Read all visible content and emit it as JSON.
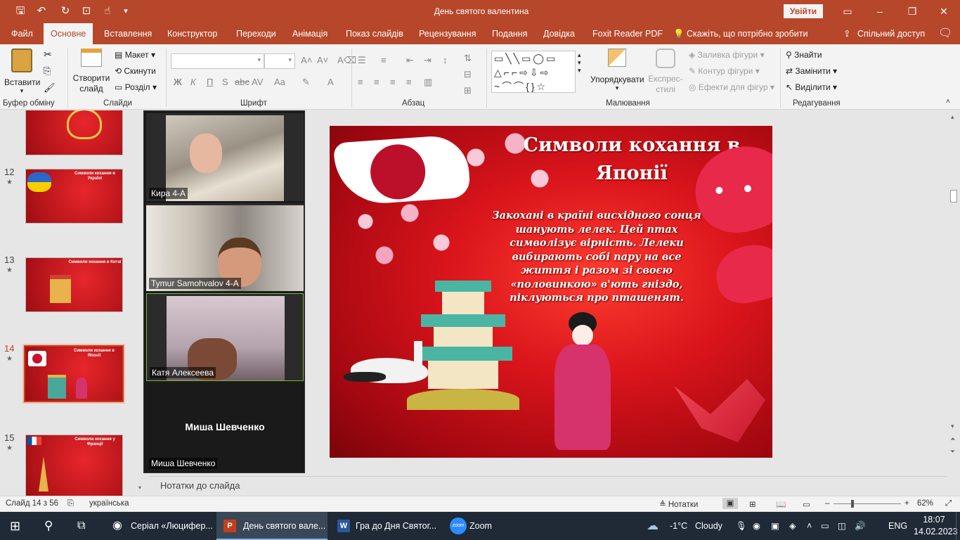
{
  "window": {
    "title": "День святого валентина",
    "signin_label": "Увійти",
    "qat": [
      "save-icon",
      "undo-icon",
      "redo-icon",
      "present-icon",
      "touch-icon",
      "customize-icon"
    ]
  },
  "tabs": [
    {
      "label": "Файл",
      "active": false
    },
    {
      "label": "Основне",
      "active": true
    },
    {
      "label": "Вставлення",
      "active": false
    },
    {
      "label": "Конструктор",
      "active": false
    },
    {
      "label": "Переходи",
      "active": false
    },
    {
      "label": "Анімація",
      "active": false
    },
    {
      "label": "Показ слайдів",
      "active": false
    },
    {
      "label": "Рецензування",
      "active": false
    },
    {
      "label": "Подання",
      "active": false
    },
    {
      "label": "Довідка",
      "active": false
    },
    {
      "label": "Foxit Reader PDF",
      "active": false
    }
  ],
  "tell_me": "Скажіть, що потрібно зробити",
  "share_label": "Спільний доступ",
  "ribbon": {
    "clipboard": {
      "paste": "Вставити",
      "group": "Буфер обміну"
    },
    "slides": {
      "new_slide": "Створити слайд",
      "layout": "Макет",
      "reset": "Скинути",
      "section": "Розділ",
      "group": "Слайди"
    },
    "font": {
      "group": "Шрифт",
      "bold": "Ж",
      "italic": "К",
      "underline": "П",
      "strike": "S",
      "spacing": "AV",
      "case": "Aa",
      "color": "A"
    },
    "paragraph": {
      "group": "Абзац"
    },
    "drawing": {
      "arrange": "Упорядкувати",
      "quick_styles": "Експрес-стилі",
      "fill": "Заливка фігури",
      "outline": "Контур фігури",
      "effects": "Ефекти для фігур",
      "group": "Малювання"
    },
    "editing": {
      "find": "Знайти",
      "replace": "Замінити",
      "select": "Виділити",
      "group": "Редагування"
    }
  },
  "thumbnails": [
    {
      "num": "",
      "title": "",
      "star": false
    },
    {
      "num": "12",
      "title": "Символи кохання в Україні",
      "star": true
    },
    {
      "num": "13",
      "title": "Символи кохання в Китаї",
      "star": true
    },
    {
      "num": "14",
      "title": "Символи кохання в Японії",
      "star": true,
      "selected": true
    },
    {
      "num": "15",
      "title": "Символи кохання у Франції",
      "star": true
    }
  ],
  "zoom": {
    "participants": [
      {
        "name": "Кира 4-А"
      },
      {
        "name": "Tymur Samohvalov 4-A"
      },
      {
        "name": "Катя Алексеева"
      },
      {
        "name": "Миша Шевченко",
        "big_name": "Миша Шевченко"
      }
    ]
  },
  "slide": {
    "title": "Символи кохання в Японії",
    "body": "Закохані в країні висхідного сонця шанують лелек. Цей птах символізує вірність. Лелеки вибирають собі пару на все життя і разом зі своєю «половинкою» в'ють гніздо, піклуються про пташенят."
  },
  "notes_placeholder": "Нотатки до слайда",
  "status": {
    "slide_counter": "Слайд 14 з 56",
    "language": "українська",
    "notes_label": "Нотатки",
    "zoom_percent": "62%"
  },
  "taskbar": {
    "apps": [
      {
        "label": "Серіал «Люцифер...",
        "icon": "chrome-icon"
      },
      {
        "label": "День святого вале...",
        "icon": "powerpoint-icon",
        "active": true
      },
      {
        "label": "Гра  до Дня Святог...",
        "icon": "word-icon"
      },
      {
        "label": "Zoom",
        "icon": "zoom-icon"
      }
    ],
    "weather": {
      "temp": "-1°C",
      "text": "Cloudy"
    },
    "lang": "ENG",
    "time": "18:07",
    "date": "14.02.2023"
  }
}
